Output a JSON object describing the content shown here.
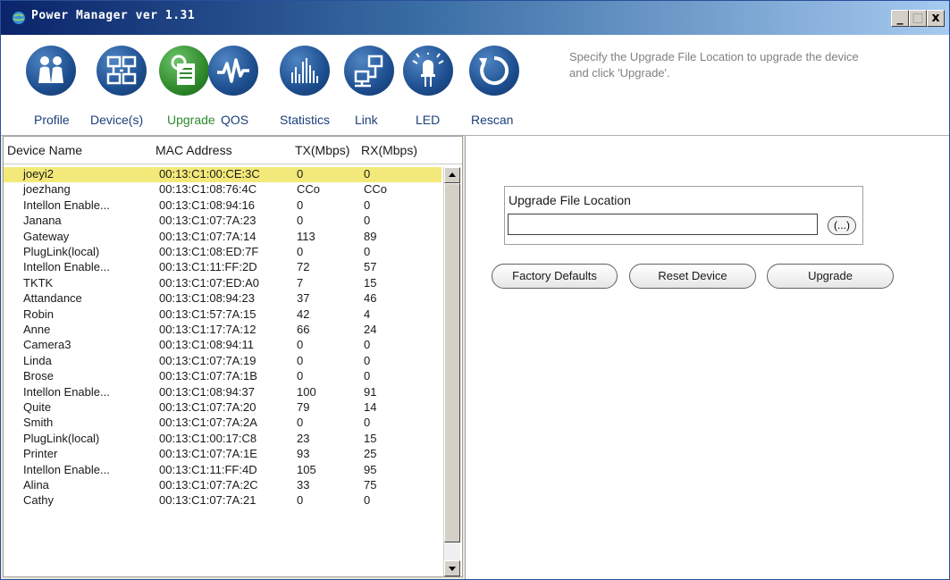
{
  "window": {
    "title": "Power Manager ver 1.31",
    "min_glyph": "_",
    "max_glyph": "□",
    "close_glyph": "x"
  },
  "toolbar": {
    "items": [
      {
        "label": "Profile",
        "icon": "people-icon",
        "active": false
      },
      {
        "label": "Device(s)",
        "icon": "devices-icon",
        "active": false
      },
      {
        "label": "Upgrade",
        "icon": "upgrade-icon",
        "active": true
      },
      {
        "label": "QOS",
        "icon": "waveform-icon",
        "active": false
      },
      {
        "label": "Statistics",
        "icon": "bar-chart-icon",
        "active": false
      },
      {
        "label": "Link",
        "icon": "network-link-icon",
        "active": false
      },
      {
        "label": "LED",
        "icon": "led-icon",
        "active": false
      },
      {
        "label": "Rescan",
        "icon": "rescan-icon",
        "active": false
      }
    ],
    "hint": "Specify the Upgrade File Location to upgrade the device and click 'Upgrade'."
  },
  "devices": {
    "columns": [
      "Device Name",
      "MAC Address",
      "TX(Mbps)",
      "RX(Mbps)"
    ],
    "rows": [
      [
        "joeyi2",
        "00:13:C1:00:CE:3C",
        "0",
        "0"
      ],
      [
        "joezhang",
        "00:13:C1:08:76:4C",
        "CCo",
        "CCo"
      ],
      [
        "Intellon Enable...",
        "00:13:C1:08:94:16",
        "0",
        "0"
      ],
      [
        "Janana",
        "00:13:C1:07:7A:23",
        "0",
        "0"
      ],
      [
        "Gateway",
        "00:13:C1:07:7A:14",
        "113",
        "89"
      ],
      [
        "PlugLink(local)",
        "00:13:C1:08:ED:7F",
        "0",
        "0"
      ],
      [
        "Intellon Enable...",
        "00:13:C1:11:FF:2D",
        "72",
        "57"
      ],
      [
        "TKTK",
        "00:13:C1:07:ED:A0",
        "7",
        "15"
      ],
      [
        "Attandance",
        "00:13:C1:08:94:23",
        "37",
        "46"
      ],
      [
        "Robin",
        "00:13:C1:57:7A:15",
        "42",
        "4"
      ],
      [
        "Anne",
        "00:13:C1:17:7A:12",
        "66",
        "24"
      ],
      [
        "Camera3",
        "00:13:C1:08:94:11",
        "0",
        "0"
      ],
      [
        "Linda",
        "00:13:C1:07:7A:19",
        "0",
        "0"
      ],
      [
        "Brose",
        "00:13:C1:07:7A:1B",
        "0",
        "0"
      ],
      [
        "Intellon Enable...",
        "00:13:C1:08:94:37",
        "100",
        "91"
      ],
      [
        "Quite",
        "00:13:C1:07:7A:20",
        "79",
        "14"
      ],
      [
        "Smith",
        "00:13:C1:07:7A:2A",
        "0",
        "0"
      ],
      [
        "PlugLink(local)",
        "00:13:C1:00:17:C8",
        "23",
        "15"
      ],
      [
        "Printer",
        "00:13:C1:07:7A:1E",
        "93",
        "25"
      ],
      [
        "Intellon Enable...",
        "00:13:C1:11:FF:4D",
        "105",
        "95"
      ],
      [
        "Alina",
        "00:13:C1:07:7A:2C",
        "33",
        "75"
      ],
      [
        "Cathy",
        "00:13:C1:07:7A:21",
        "0",
        "0"
      ]
    ],
    "selected_index": 0
  },
  "upgrade": {
    "group_label": "Upgrade File Location",
    "path_value": "",
    "browse_label": "(...)",
    "buttons": {
      "factory": "Factory Defaults",
      "reset": "Reset Device",
      "upgrade": "Upgrade"
    }
  },
  "colors": {
    "title_bar": "#0a246a",
    "selection": "#f3e97a",
    "icon_blue": "#1d4e8f",
    "icon_active_green": "#2f8a2b"
  }
}
